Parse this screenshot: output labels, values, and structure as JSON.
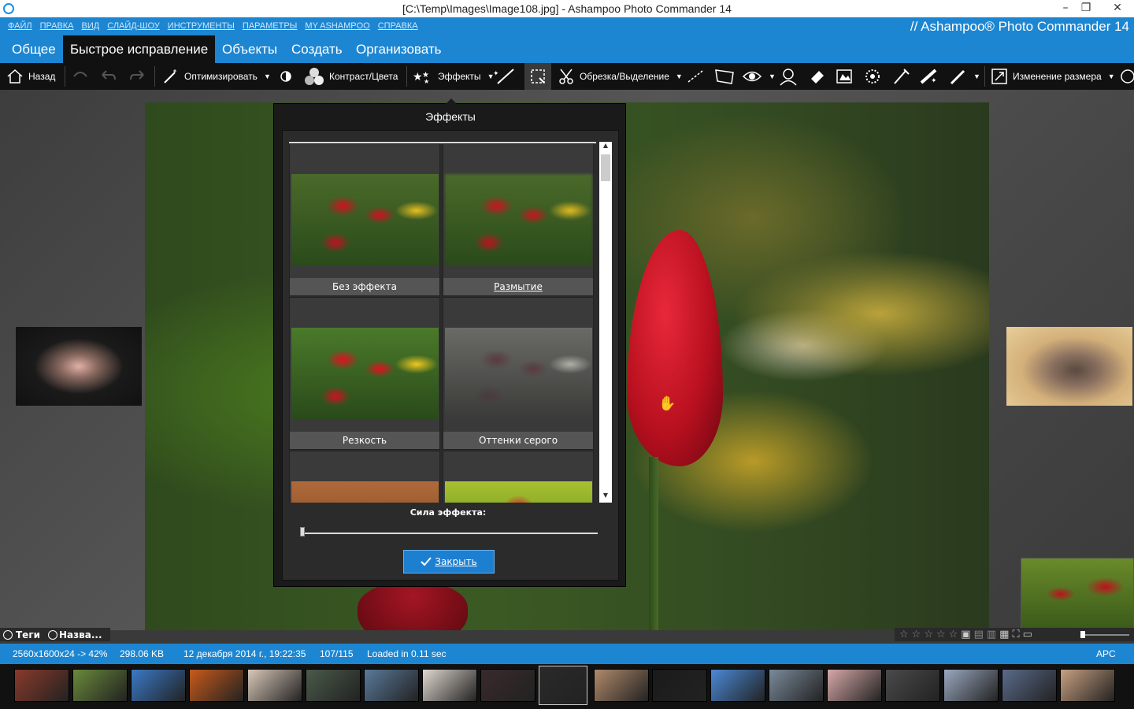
{
  "window": {
    "title": "[C:\\Temp\\Images\\Image108.jpg] - Ashampoo Photo Commander 14"
  },
  "menubar": {
    "items": [
      "ФАЙЛ",
      "ПРАВКА",
      "ВИД",
      "СЛАЙД-ШОУ",
      "ИНСТРУМЕНТЫ",
      "ПАРАМЕТРЫ",
      "MY ASHAMPOO",
      "СПРАВКА"
    ],
    "brand": "// Ashampoo® Photo Commander 14"
  },
  "tabs": [
    {
      "label": "Общее"
    },
    {
      "label": "Быстрое исправление",
      "active": true
    },
    {
      "label": "Объекты"
    },
    {
      "label": "Создать"
    },
    {
      "label": "Организовать"
    }
  ],
  "toolbar": {
    "back": "Назад",
    "optimize": "Оптимизировать",
    "contrast": "Контраст/Цвета",
    "effects": "Эффекты",
    "crop": "Обрезка/Выделение",
    "resize": "Изменение размера"
  },
  "bottom_left": {
    "tags": "Теги",
    "name": "Назва..."
  },
  "dialog": {
    "title": "Эффекты",
    "effects": [
      {
        "label": "Без эффекта"
      },
      {
        "label": "Размытие"
      },
      {
        "label": "Резкость"
      },
      {
        "label": "Оттенки серого"
      }
    ],
    "strength_label": "Сила эффекта:",
    "strength_value": 0,
    "close": "Закрыть"
  },
  "status": {
    "dimensions": "2560x1600x24 -> 42%",
    "size": "298.06 KB",
    "date": "12 декабря 2014 г., 19:22:35",
    "index": "107/115",
    "load": "Loaded in 0.11 sec",
    "apc": "APC"
  },
  "filmstrip": {
    "colors": [
      "#8a3a2a",
      "#6a8a3a",
      "#3a7ac8",
      "#c85a1a",
      "#d8c8b8",
      "#4a5a4a",
      "#5a7a9a",
      "#e0d8d0",
      "#3a2a2a",
      "#2a2a2a",
      "#b08a6a",
      "#1a1a1a",
      "#4a8ad8",
      "#7a8a9a",
      "#d8a8a8",
      "#4a4a4a",
      "#9aa8c0",
      "#5a6a8a",
      "#c8a080"
    ]
  },
  "colors": {
    "accent": "#1d86d2",
    "dialog_bg": "#1a1a1a",
    "close_button": "#1d7fd0"
  }
}
